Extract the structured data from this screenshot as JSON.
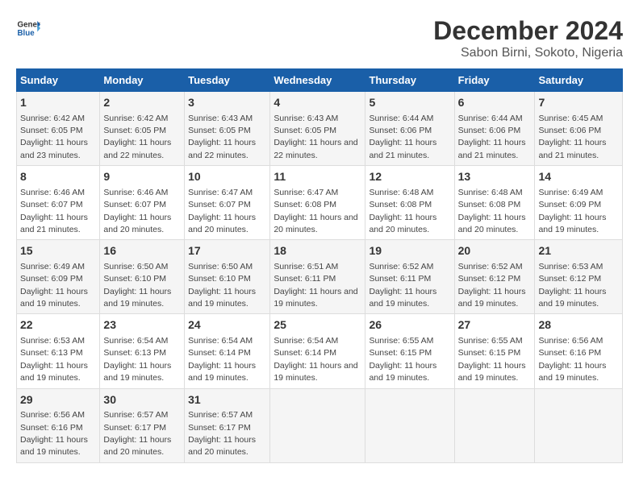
{
  "logo": {
    "line1": "General",
    "line2": "Blue"
  },
  "title": "December 2024",
  "subtitle": "Sabon Birni, Sokoto, Nigeria",
  "days_header": [
    "Sunday",
    "Monday",
    "Tuesday",
    "Wednesday",
    "Thursday",
    "Friday",
    "Saturday"
  ],
  "weeks": [
    [
      {
        "day": "1",
        "sunrise": "6:42 AM",
        "sunset": "6:05 PM",
        "daylight": "11 hours and 23 minutes."
      },
      {
        "day": "2",
        "sunrise": "6:42 AM",
        "sunset": "6:05 PM",
        "daylight": "11 hours and 22 minutes."
      },
      {
        "day": "3",
        "sunrise": "6:43 AM",
        "sunset": "6:05 PM",
        "daylight": "11 hours and 22 minutes."
      },
      {
        "day": "4",
        "sunrise": "6:43 AM",
        "sunset": "6:05 PM",
        "daylight": "11 hours and 22 minutes."
      },
      {
        "day": "5",
        "sunrise": "6:44 AM",
        "sunset": "6:06 PM",
        "daylight": "11 hours and 21 minutes."
      },
      {
        "day": "6",
        "sunrise": "6:44 AM",
        "sunset": "6:06 PM",
        "daylight": "11 hours and 21 minutes."
      },
      {
        "day": "7",
        "sunrise": "6:45 AM",
        "sunset": "6:06 PM",
        "daylight": "11 hours and 21 minutes."
      }
    ],
    [
      {
        "day": "8",
        "sunrise": "6:46 AM",
        "sunset": "6:07 PM",
        "daylight": "11 hours and 21 minutes."
      },
      {
        "day": "9",
        "sunrise": "6:46 AM",
        "sunset": "6:07 PM",
        "daylight": "11 hours and 20 minutes."
      },
      {
        "day": "10",
        "sunrise": "6:47 AM",
        "sunset": "6:07 PM",
        "daylight": "11 hours and 20 minutes."
      },
      {
        "day": "11",
        "sunrise": "6:47 AM",
        "sunset": "6:08 PM",
        "daylight": "11 hours and 20 minutes."
      },
      {
        "day": "12",
        "sunrise": "6:48 AM",
        "sunset": "6:08 PM",
        "daylight": "11 hours and 20 minutes."
      },
      {
        "day": "13",
        "sunrise": "6:48 AM",
        "sunset": "6:08 PM",
        "daylight": "11 hours and 20 minutes."
      },
      {
        "day": "14",
        "sunrise": "6:49 AM",
        "sunset": "6:09 PM",
        "daylight": "11 hours and 19 minutes."
      }
    ],
    [
      {
        "day": "15",
        "sunrise": "6:49 AM",
        "sunset": "6:09 PM",
        "daylight": "11 hours and 19 minutes."
      },
      {
        "day": "16",
        "sunrise": "6:50 AM",
        "sunset": "6:10 PM",
        "daylight": "11 hours and 19 minutes."
      },
      {
        "day": "17",
        "sunrise": "6:50 AM",
        "sunset": "6:10 PM",
        "daylight": "11 hours and 19 minutes."
      },
      {
        "day": "18",
        "sunrise": "6:51 AM",
        "sunset": "6:11 PM",
        "daylight": "11 hours and 19 minutes."
      },
      {
        "day": "19",
        "sunrise": "6:52 AM",
        "sunset": "6:11 PM",
        "daylight": "11 hours and 19 minutes."
      },
      {
        "day": "20",
        "sunrise": "6:52 AM",
        "sunset": "6:12 PM",
        "daylight": "11 hours and 19 minutes."
      },
      {
        "day": "21",
        "sunrise": "6:53 AM",
        "sunset": "6:12 PM",
        "daylight": "11 hours and 19 minutes."
      }
    ],
    [
      {
        "day": "22",
        "sunrise": "6:53 AM",
        "sunset": "6:13 PM",
        "daylight": "11 hours and 19 minutes."
      },
      {
        "day": "23",
        "sunrise": "6:54 AM",
        "sunset": "6:13 PM",
        "daylight": "11 hours and 19 minutes."
      },
      {
        "day": "24",
        "sunrise": "6:54 AM",
        "sunset": "6:14 PM",
        "daylight": "11 hours and 19 minutes."
      },
      {
        "day": "25",
        "sunrise": "6:54 AM",
        "sunset": "6:14 PM",
        "daylight": "11 hours and 19 minutes."
      },
      {
        "day": "26",
        "sunrise": "6:55 AM",
        "sunset": "6:15 PM",
        "daylight": "11 hours and 19 minutes."
      },
      {
        "day": "27",
        "sunrise": "6:55 AM",
        "sunset": "6:15 PM",
        "daylight": "11 hours and 19 minutes."
      },
      {
        "day": "28",
        "sunrise": "6:56 AM",
        "sunset": "6:16 PM",
        "daylight": "11 hours and 19 minutes."
      }
    ],
    [
      {
        "day": "29",
        "sunrise": "6:56 AM",
        "sunset": "6:16 PM",
        "daylight": "11 hours and 19 minutes."
      },
      {
        "day": "30",
        "sunrise": "6:57 AM",
        "sunset": "6:17 PM",
        "daylight": "11 hours and 20 minutes."
      },
      {
        "day": "31",
        "sunrise": "6:57 AM",
        "sunset": "6:17 PM",
        "daylight": "11 hours and 20 minutes."
      },
      {
        "day": "",
        "sunrise": "",
        "sunset": "",
        "daylight": ""
      },
      {
        "day": "",
        "sunrise": "",
        "sunset": "",
        "daylight": ""
      },
      {
        "day": "",
        "sunrise": "",
        "sunset": "",
        "daylight": ""
      },
      {
        "day": "",
        "sunrise": "",
        "sunset": "",
        "daylight": ""
      }
    ]
  ]
}
